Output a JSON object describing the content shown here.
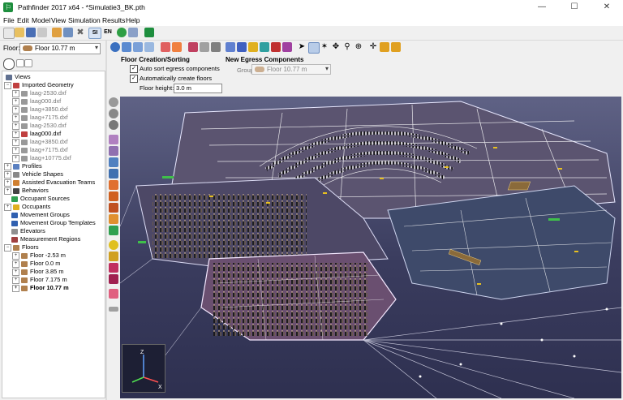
{
  "window": {
    "title": "Pathfinder 2017 x64 - *Simulatie3_BK.pth",
    "minimize": "—",
    "maximize": "☐",
    "close": "✕"
  },
  "menu": [
    "File",
    "Edit",
    "Model",
    "View",
    "Simulation",
    "Results",
    "Help"
  ],
  "toolbar": {
    "si_label": "SI",
    "en_label": "EN"
  },
  "floor_selector": {
    "label": "Floor:",
    "value": "Floor 10.77 m"
  },
  "tree": {
    "views": "Views",
    "imported_geometry": "Imported Geometry",
    "geometry_items": [
      "laag-2530.dxf",
      "laag000.dxf",
      "laag+3850.dxf",
      "laag+7175.dxf",
      "laag-2530.dxf",
      "laag000.dxf",
      "laag+3850.dxf",
      "laag+7175.dxf",
      "laag+10775.dxf"
    ],
    "profiles": "Profiles",
    "vehicle_shapes": "Vehicle Shapes",
    "assisted_evac": "Assisted Evacuation Teams",
    "behaviors": "Behaviors",
    "occupant_sources": "Occupant Sources",
    "occupants": "Occupants",
    "movement_groups": "Movement Groups",
    "movement_group_templates": "Movement Group Templates",
    "elevators": "Elevators",
    "measurement_regions": "Measurement Regions",
    "floors": "Floors",
    "floor_items": [
      "Floor -2.53 m",
      "Floor 0.0 m",
      "Floor 3.85 m",
      "Floor 7.175 m",
      "Floor 10.77 m"
    ]
  },
  "panel": {
    "creation_title": "Floor Creation/Sorting",
    "auto_sort": "Auto sort egress components",
    "auto_create": "Automatically create floors",
    "floor_height_label": "Floor height:",
    "floor_height_value": "3.0 m",
    "new_egress_title": "New Egress Components",
    "group_label": "Group:",
    "group_value": "Floor 10.77 m"
  },
  "axes": {
    "z": "Z",
    "x": "X"
  }
}
